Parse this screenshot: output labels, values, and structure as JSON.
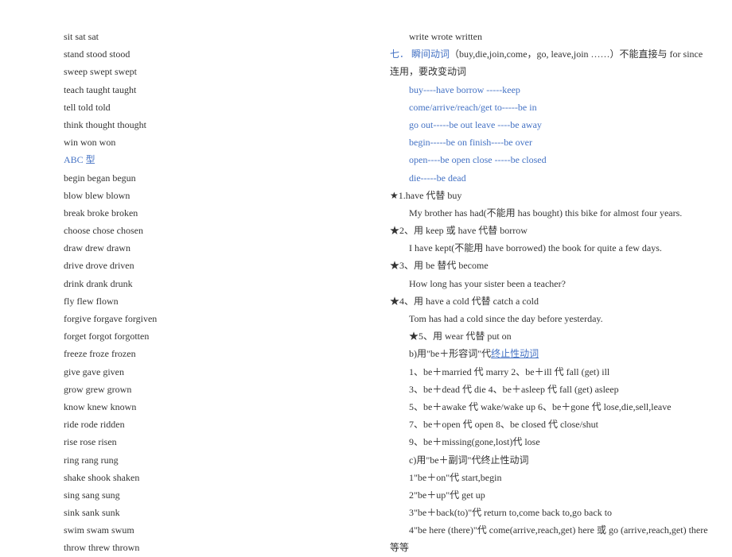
{
  "left": {
    "verbs1": [
      "sit  sat  sat",
      "stand  stood  stood",
      "sweep  swept  swept",
      "teach  taught  taught",
      "tell  told  told",
      "think  thought  thought",
      "win  won  won"
    ],
    "heading": "ABC 型",
    "verbs2": [
      "begin  began  begun",
      "blow  blew  blown",
      "break  broke  broken",
      "choose  chose  chosen",
      "draw  drew  drawn",
      "drive  drove  driven",
      "drink  drank  drunk",
      "fly  flew  flown",
      "forgive  forgave  forgiven",
      "forget  forgot  forgotten",
      "freeze  froze  frozen",
      "give  gave  given",
      "grow  grew  grown",
      "know  knew  known",
      "ride  rode  ridden",
      "rise  rose  risen",
      "ring  rang  rung",
      "shake  shook  shaken",
      "sing  sang  sung",
      "sink  sank  sunk",
      "swim  swam  swum",
      "throw  threw  thrown"
    ]
  },
  "right": {
    "r1": "write  wrote  written",
    "r2a": "七．  瞬间动词",
    "r2b": "（buy,die,join,come，go,  leave,join  ……）不能直接与 for  since",
    "r3": "连用，要改变动词",
    "blue_lines": [
      "buy----have    borrow  -----keep",
      "come/arrive/reach/get  to-----be  in",
      "go  out-----be  out     leave  ----be  away",
      "begin-----be  on          finish----be  over",
      "open----be  open      close  -----be  closed",
      "die-----be  dead"
    ],
    "s1": "★1.have 代替 buy",
    "s1e": "My  brother  has  had(不能用 has  bought)  this  bike  for  almost  four  years.",
    "s2": "★2、用 keep 或 have 代替 borrow",
    "s2e": "I  have  kept(不能用 have  borrowed)  the  book  for  quite  a  few  days.",
    "s3": "★3、用 be 替代 become",
    "s3e": "How  long  has  your  sister  been  a  teacher?",
    "s4": "★4、用 have  a  cold 代替 catch  a  cold",
    "s4e": "Tom  has  had  a  cold  since  the  day  before  yesterday.",
    "s5": "★5、用 wear 代替 put  on",
    "s5b_a": "b)用\"be＋形容词\"代",
    "s5b_link": "终止性动词",
    "lines": [
      "1、be＋married 代 marry  2、be＋ill 代 fall  (get)  ill",
      "3、be＋dead 代 die  4、be＋asleep 代 fall  (get)  asleep",
      "5、be＋awake 代 wake/wake  up  6、be＋gone 代 lose,die,sell,leave",
      "7、be＋open 代 open  8、be  closed 代 close/shut",
      "9、be＋missing(gone,lost)代 lose",
      "c)用\"be＋副词\"代终止性动词",
      "1\"be＋on\"代 start,begin",
      "2\"be＋up\"代 get  up",
      "3\"be＋back(to)\"代 return  to,come  back  to,go  back  to",
      "4\"be  here  (there)\"代 come(arrive,reach,get)  here 或 go  (arrive,reach,get)  there"
    ],
    "last": "等等"
  }
}
